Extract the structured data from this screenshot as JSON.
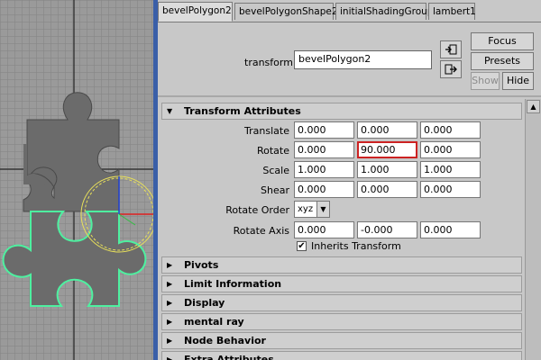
{
  "tabs": [
    {
      "label": "bevelPolygon2",
      "active": true
    },
    {
      "label": "bevelPolygonShape2",
      "active": false
    },
    {
      "label": "initialShadingGroup",
      "active": false
    },
    {
      "label": "lambert1",
      "active": false
    }
  ],
  "header": {
    "transform_label": "transform:",
    "transform_value": "bevelPolygon2",
    "focus_label": "Focus",
    "presets_label": "Presets",
    "show_label": "Show",
    "hide_label": "Hide",
    "load_icon": "select-node-icon",
    "copy_icon": "copy-tab-icon"
  },
  "transform_section": {
    "title": "Transform Attributes",
    "rows": [
      {
        "label": "Translate",
        "values": [
          "0.000",
          "0.000",
          "0.000"
        ]
      },
      {
        "label": "Rotate",
        "values": [
          "0.000",
          "90.000",
          "0.000"
        ]
      },
      {
        "label": "Scale",
        "values": [
          "1.000",
          "1.000",
          "1.000"
        ]
      },
      {
        "label": "Shear",
        "values": [
          "0.000",
          "0.000",
          "0.000"
        ]
      }
    ],
    "rotate_order_label": "Rotate Order",
    "rotate_order_value": "xyz",
    "rotate_axis_label": "Rotate Axis",
    "rotate_axis_values": [
      "0.000",
      "-0.000",
      "0.000"
    ],
    "inherits_label": "Inherits Transform",
    "inherits_checked": true
  },
  "sections": [
    {
      "title": "Pivots"
    },
    {
      "title": "Limit Information"
    },
    {
      "title": "Display"
    },
    {
      "title": "mental ray"
    },
    {
      "title": "Node Behavior"
    },
    {
      "title": "Extra Attributes"
    }
  ],
  "colors": {
    "viewport_bg": "#9a9a9a",
    "viewport_border": "#3a5fa8",
    "piece_fill": "#6b6b6b",
    "selection_outline": "#4ef0a0",
    "highlight_field": "#cc2222"
  }
}
